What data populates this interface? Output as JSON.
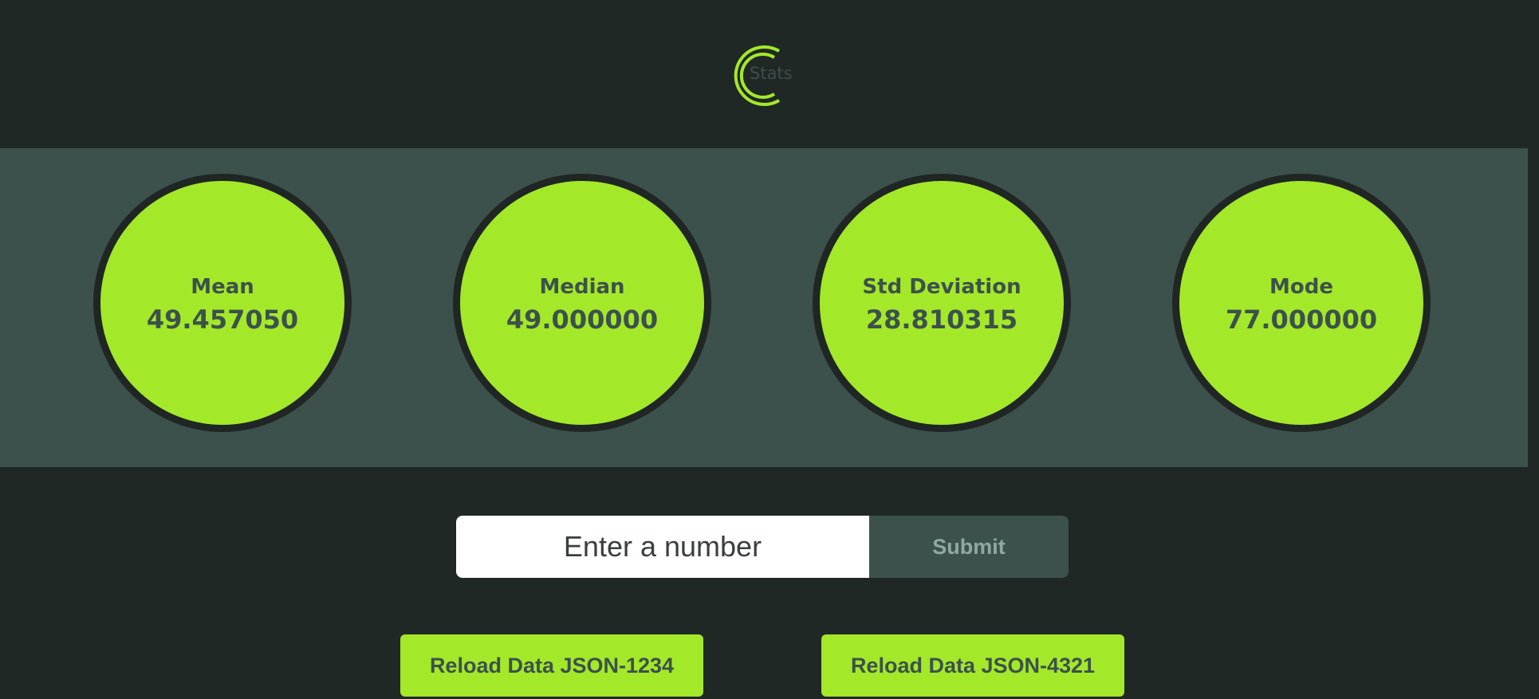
{
  "header": {
    "logo_text": "Stats",
    "accent_color": "#a4e82a"
  },
  "stats": [
    {
      "label": "Mean",
      "value": "49.457050"
    },
    {
      "label": "Median",
      "value": "49.000000"
    },
    {
      "label": "Std Deviation",
      "value": "28.810315"
    },
    {
      "label": "Mode",
      "value": "77.000000"
    }
  ],
  "form": {
    "input_placeholder": "Enter a number",
    "input_value": "",
    "submit_label": "Submit"
  },
  "actions": {
    "reload_1_label": "Reload Data JSON-1234",
    "reload_2_label": "Reload Data JSON-4321"
  },
  "colors": {
    "background": "#202826",
    "band": "#3c514b",
    "circle": "#a4e82a",
    "text_dark": "#3c514b"
  }
}
